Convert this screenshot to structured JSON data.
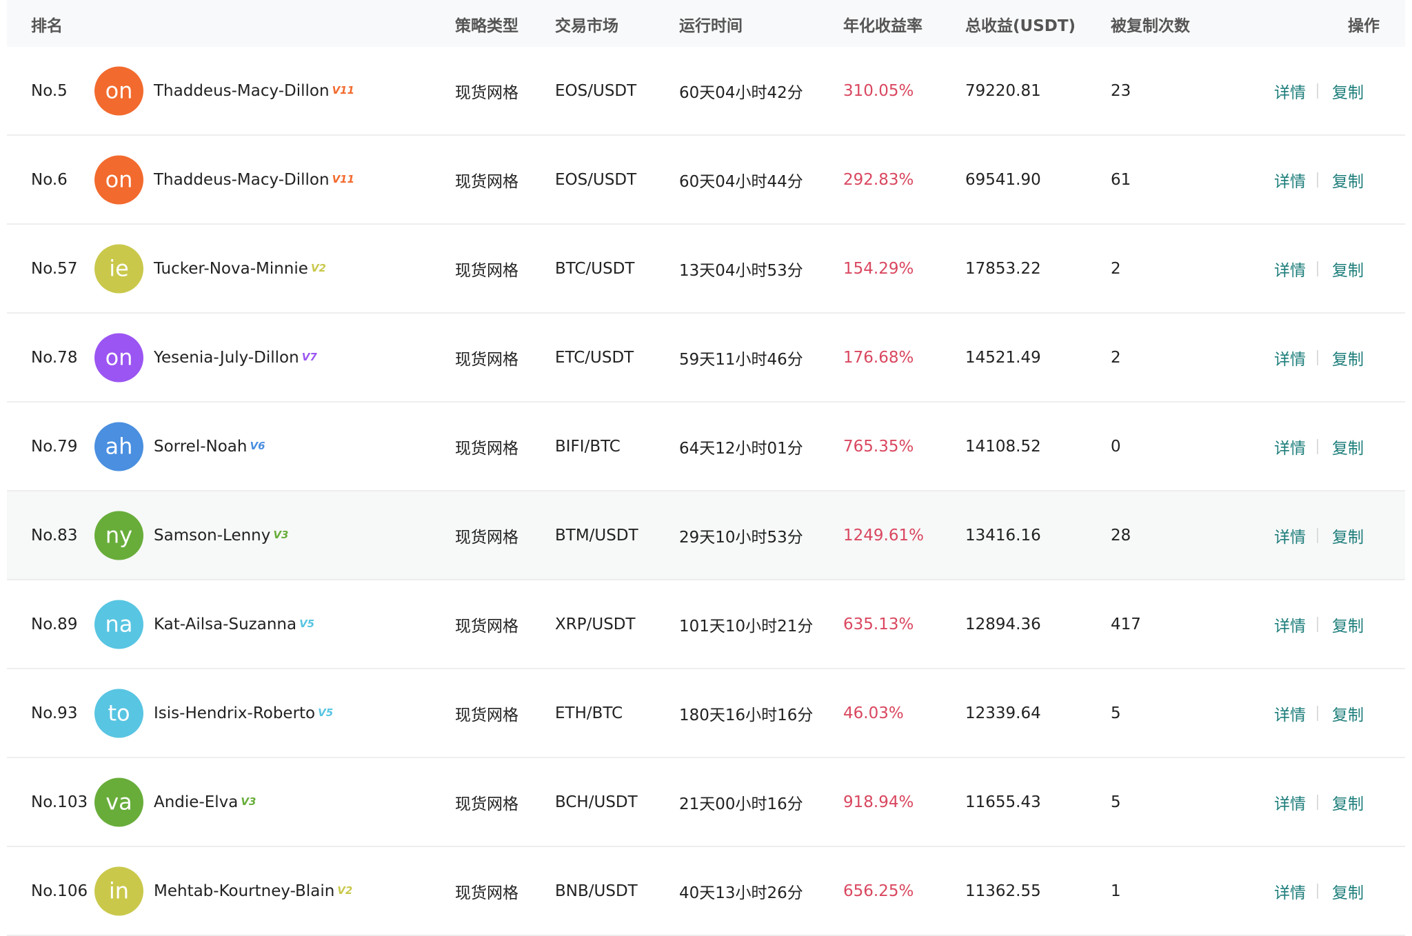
{
  "headers": {
    "rank": "排名",
    "strategy_type": "策略类型",
    "market": "交易市场",
    "run_time": "运行时间",
    "annual_return": "年化收益率",
    "total_profit": "总收益(USDT)",
    "copied_count": "被复制次数",
    "action": "操作"
  },
  "rows": [
    {
      "rank": "No.5",
      "avatar": "on",
      "avatar_color": "#f26a2e",
      "name": "Thaddeus-Macy-Dillon",
      "level": "V11",
      "level_color": "#f26a2e",
      "type": "现货网格",
      "market": "EOS/USDT",
      "time": "60天04小时42分",
      "annual": "310.05%",
      "total": "79220.81",
      "copies": "23",
      "detail": "详情",
      "copy": "复制"
    },
    {
      "rank": "No.6",
      "avatar": "on",
      "avatar_color": "#f26a2e",
      "name": "Thaddeus-Macy-Dillon",
      "level": "V11",
      "level_color": "#f26a2e",
      "type": "现货网格",
      "market": "EOS/USDT",
      "time": "60天04小时44分",
      "annual": "292.83%",
      "total": "69541.90",
      "copies": "61",
      "detail": "详情",
      "copy": "复制"
    },
    {
      "rank": "No.57",
      "avatar": "ie",
      "avatar_color": "#c9c84b",
      "name": "Tucker-Nova-Minnie",
      "level": "V2",
      "level_color": "#c9c84b",
      "type": "现货网格",
      "market": "BTC/USDT",
      "time": "13天04小时53分",
      "annual": "154.29%",
      "total": "17853.22",
      "copies": "2",
      "detail": "详情",
      "copy": "复制"
    },
    {
      "rank": "No.78",
      "avatar": "on",
      "avatar_color": "#9b55f2",
      "name": "Yesenia-July-Dillon",
      "level": "V7",
      "level_color": "#9b55f2",
      "type": "现货网格",
      "market": "ETC/USDT",
      "time": "59天11小时46分",
      "annual": "176.68%",
      "total": "14521.49",
      "copies": "2",
      "detail": "详情",
      "copy": "复制"
    },
    {
      "rank": "No.79",
      "avatar": "ah",
      "avatar_color": "#4a8fe0",
      "name": "Sorrel-Noah",
      "level": "V6",
      "level_color": "#4a8fe0",
      "type": "现货网格",
      "market": "BIFI/BTC",
      "time": "64天12小时01分",
      "annual": "765.35%",
      "total": "14108.52",
      "copies": "0",
      "detail": "详情",
      "copy": "复制"
    },
    {
      "rank": "No.83",
      "avatar": "ny",
      "avatar_color": "#68ad3a",
      "name": "Samson-Lenny",
      "level": "V3",
      "level_color": "#68ad3a",
      "type": "现货网格",
      "market": "BTM/USDT",
      "time": "29天10小时53分",
      "annual": "1249.61%",
      "total": "13416.16",
      "copies": "28",
      "detail": "详情",
      "copy": "复制",
      "highlight": true
    },
    {
      "rank": "No.89",
      "avatar": "na",
      "avatar_color": "#58c5e2",
      "name": "Kat-Ailsa-Suzanna",
      "level": "V5",
      "level_color": "#58c5e2",
      "type": "现货网格",
      "market": "XRP/USDT",
      "time": "101天10小时21分",
      "annual": "635.13%",
      "total": "12894.36",
      "copies": "417",
      "detail": "详情",
      "copy": "复制"
    },
    {
      "rank": "No.93",
      "avatar": "to",
      "avatar_color": "#58c5e2",
      "name": "Isis-Hendrix-Roberto",
      "level": "V5",
      "level_color": "#58c5e2",
      "type": "现货网格",
      "market": "ETH/BTC",
      "time": "180天16小时16分",
      "annual": "46.03%",
      "total": "12339.64",
      "copies": "5",
      "detail": "详情",
      "copy": "复制"
    },
    {
      "rank": "No.103",
      "avatar": "va",
      "avatar_color": "#68ad3a",
      "name": "Andie-Elva",
      "level": "V3",
      "level_color": "#68ad3a",
      "type": "现货网格",
      "market": "BCH/USDT",
      "time": "21天00小时16分",
      "annual": "918.94%",
      "total": "11655.43",
      "copies": "5",
      "detail": "详情",
      "copy": "复制"
    },
    {
      "rank": "No.106",
      "avatar": "in",
      "avatar_color": "#c9c84b",
      "name": "Mehtab-Kourtney-Blain",
      "level": "V2",
      "level_color": "#c9c84b",
      "type": "现货网格",
      "market": "BNB/USDT",
      "time": "40天13小时26分",
      "annual": "656.25%",
      "total": "11362.55",
      "copies": "1",
      "detail": "详情",
      "copy": "复制"
    }
  ]
}
